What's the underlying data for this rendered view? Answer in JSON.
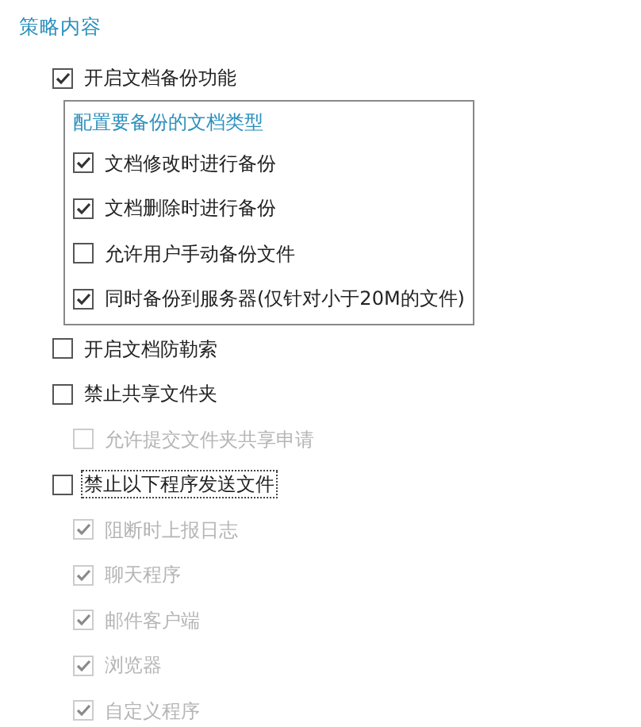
{
  "title": "策略内容",
  "options": [
    {
      "kind": "checkbox",
      "label": "开启文档备份功能",
      "checked": true,
      "disabled": false,
      "focused": false
    },
    {
      "kind": "group",
      "title": "配置要备份的文档类型",
      "items": [
        {
          "kind": "checkbox",
          "label": "文档修改时进行备份",
          "checked": true,
          "disabled": false,
          "focused": false
        },
        {
          "kind": "checkbox",
          "label": "文档删除时进行备份",
          "checked": true,
          "disabled": false,
          "focused": false
        },
        {
          "kind": "checkbox",
          "label": "允许用户手动备份文件",
          "checked": false,
          "disabled": false,
          "focused": false
        },
        {
          "kind": "checkbox",
          "label": "同时备份到服务器(仅针对小于20M的文件)",
          "checked": true,
          "disabled": false,
          "focused": false
        }
      ]
    },
    {
      "kind": "checkbox",
      "label": "开启文档防勒索",
      "checked": false,
      "disabled": false,
      "focused": false
    },
    {
      "kind": "checkbox",
      "label": "禁止共享文件夹",
      "checked": false,
      "disabled": false,
      "focused": false,
      "children": [
        {
          "kind": "checkbox",
          "label": "允许提交文件夹共享申请",
          "checked": false,
          "disabled": true,
          "focused": false
        }
      ]
    },
    {
      "kind": "checkbox",
      "label": "禁止以下程序发送文件",
      "checked": false,
      "disabled": false,
      "focused": true,
      "children": [
        {
          "kind": "checkbox",
          "label": "阻断时上报日志",
          "checked": true,
          "disabled": true,
          "focused": false
        },
        {
          "kind": "checkbox",
          "label": "聊天程序",
          "checked": true,
          "disabled": true,
          "focused": false
        },
        {
          "kind": "checkbox",
          "label": "邮件客户端",
          "checked": true,
          "disabled": true,
          "focused": false
        },
        {
          "kind": "checkbox",
          "label": "浏览器",
          "checked": true,
          "disabled": true,
          "focused": false
        },
        {
          "kind": "checkbox",
          "label": "自定义程序",
          "checked": true,
          "disabled": true,
          "focused": false
        }
      ]
    }
  ]
}
